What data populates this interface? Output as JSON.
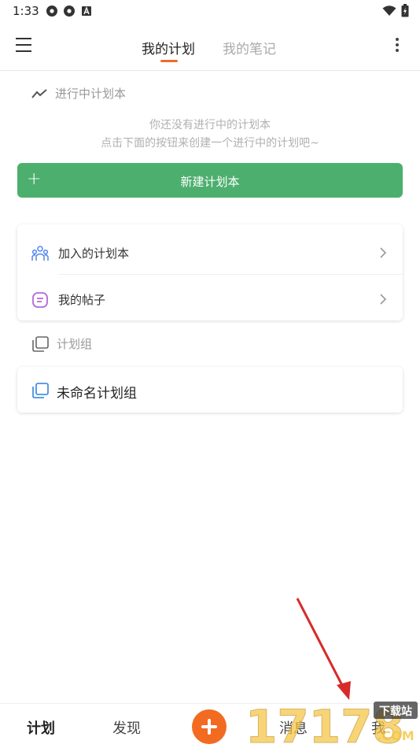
{
  "status_bar": {
    "time": "1:33",
    "icons": [
      "settings-icon",
      "settings-icon",
      "text-a-icon"
    ],
    "right_icons": [
      "wifi-icon",
      "battery-icon"
    ]
  },
  "header": {
    "menu_icon": "hamburger-icon",
    "tabs": [
      {
        "label": "我的计划",
        "active": true
      },
      {
        "label": "我的笔记",
        "active": false
      }
    ],
    "more_icon": "more-vertical-icon",
    "accent_color": "#ef6c2a"
  },
  "in_progress": {
    "icon": "trend-icon",
    "title": "进行中计划本",
    "empty_line1": "你还没有进行中的计划本",
    "empty_line2": "点击下面的按钮来创建一个进行中的计划吧~",
    "new_button": {
      "icon": "plus-icon",
      "label": "新建计划本",
      "color": "#4caf6e"
    }
  },
  "links_card": {
    "items": [
      {
        "icon": "people-icon",
        "label": "加入的计划本"
      },
      {
        "icon": "post-icon",
        "label": "我的帖子"
      }
    ]
  },
  "groups": {
    "icon": "stack-icon",
    "title": "计划组",
    "items": [
      {
        "icon": "stack-icon",
        "label": "未命名计划组"
      }
    ]
  },
  "bottom_nav": {
    "items": [
      {
        "label": "计划",
        "active": true
      },
      {
        "label": "发现",
        "active": false
      },
      {
        "label": "消息",
        "active": false
      },
      {
        "label": "我",
        "active": false
      }
    ],
    "add_button_color": "#f26b21"
  },
  "watermark": {
    "text": "17178",
    "badge": "下载站",
    "domain": ".COM"
  }
}
